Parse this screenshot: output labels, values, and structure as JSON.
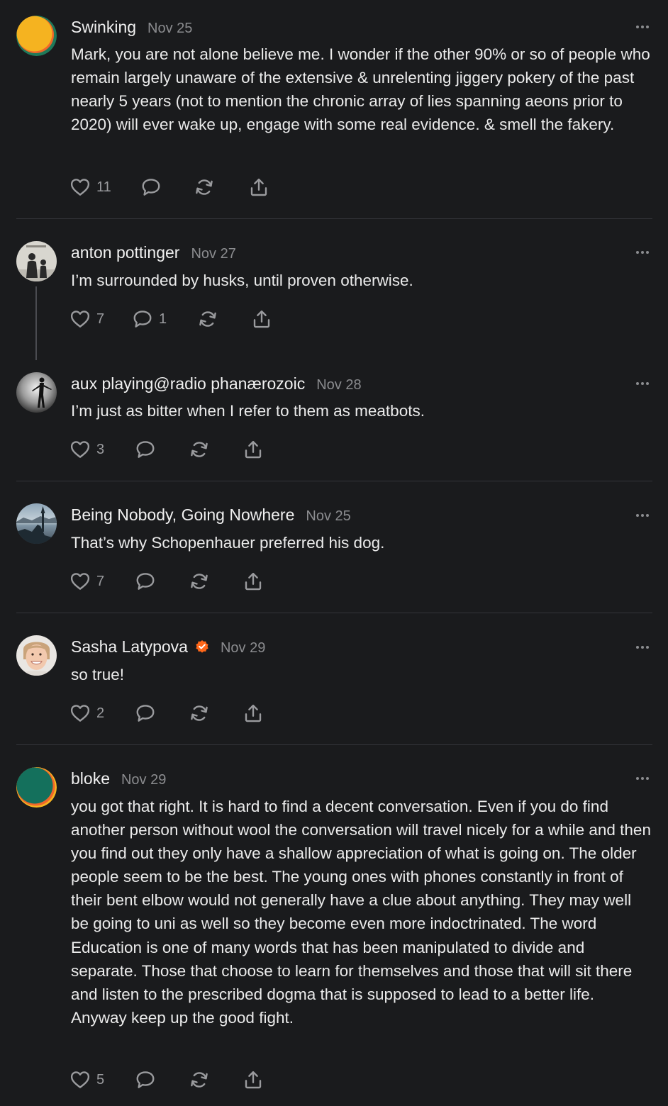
{
  "comments": [
    {
      "name": "Swinking",
      "date": "Nov 25",
      "text": "Mark, you are not alone believe me. I wonder if the other 90% or so of people who remain largely unaware of the extensive & unrelenting jiggery pokery of the past nearly 5 years (not to mention the chronic array of lies spanning aeons prior to 2020) will ever wake up, engage with some real evidence. & smell the fakery.",
      "likes": "11",
      "replies": ""
    },
    {
      "name": "anton pottinger",
      "date": "Nov 27",
      "text": "I’m surrounded by husks, until proven otherwise.",
      "likes": "7",
      "replies": "1"
    },
    {
      "name": "aux playing@radio phanærozoic",
      "date": "Nov 28",
      "text": "I’m just as bitter when I refer to them as meatbots.",
      "likes": "3",
      "replies": ""
    },
    {
      "name": "Being Nobody, Going Nowhere",
      "date": "Nov 25",
      "text": "That’s why Schopenhauer preferred his dog.",
      "likes": "7",
      "replies": ""
    },
    {
      "name": "Sasha Latypova",
      "date": "Nov 29",
      "text": "so true!",
      "likes": "2",
      "replies": "",
      "verified": true
    },
    {
      "name": "bloke",
      "date": "Nov 29",
      "text": "you got that right. It is hard to find a decent conversation. Even if you do find another person without wool the conversation will travel nicely for a while and then you find out they only have a shallow appreciation of what is going on. The older people seem to be the best. The young ones with phones constantly in front of their bent elbow would not generally have a clue about anything. They may well be going to uni as well so they become even more indoctrinated. The word Education is one of many words that has been manipulated to divide and separate. Those that choose to learn for themselves and those that will sit there and listen to the prescribed dogma that is supposed to lead to a better life. Anyway keep up the good fight.",
      "likes": "5",
      "replies": ""
    }
  ],
  "colors": {
    "background": "#1a1b1d",
    "text": "#ebebeb",
    "muted": "#8b8c8f",
    "verified": "#ff6719"
  },
  "icons": [
    "heart-icon",
    "comment-icon",
    "restack-icon",
    "share-icon",
    "more-options-icon",
    "verified-badge-icon"
  ]
}
